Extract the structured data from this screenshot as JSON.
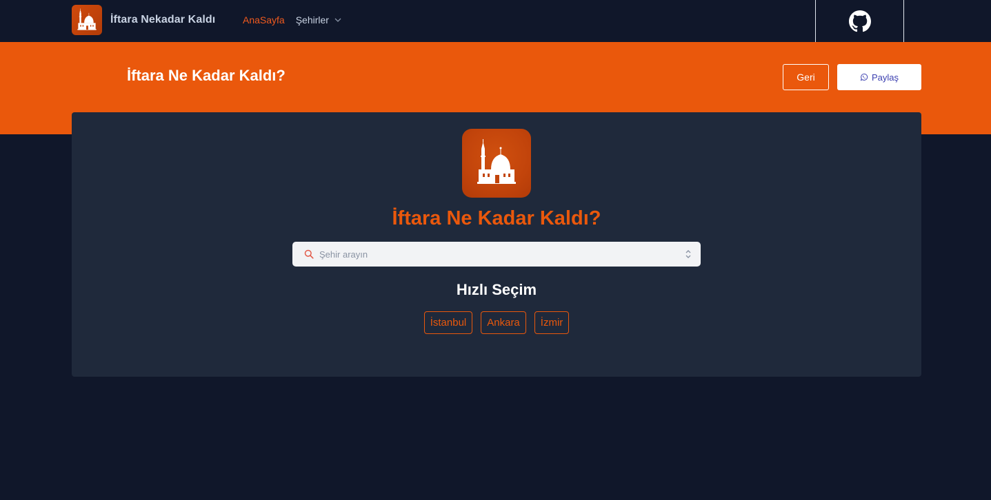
{
  "navbar": {
    "brand_title": "İftara Nekadar Kaldı",
    "links": {
      "home": "AnaSayfa",
      "cities": "Şehirler"
    }
  },
  "hero": {
    "title": "İftara Ne Kadar Kaldı?",
    "back_label": "Geri",
    "share_label": "Paylaş"
  },
  "card": {
    "title": "İftara Ne Kadar Kaldı?",
    "search": {
      "placeholder": "Şehir arayın",
      "value": ""
    },
    "quick_title": "Hızlı Seçim",
    "quick_cities": [
      "İstanbul",
      "Ankara",
      "İzmir"
    ]
  },
  "icons": {
    "logo": "mosque-icon",
    "github": "github-icon",
    "share": "whatsapp-icon",
    "search": "search-icon",
    "dropdown": "chevron-down-icon",
    "select": "sort-arrows-icon"
  },
  "colors": {
    "accent": "#ea580c",
    "nav_active": "#f05a1e",
    "background": "#10172a",
    "card": "#1f293b"
  }
}
